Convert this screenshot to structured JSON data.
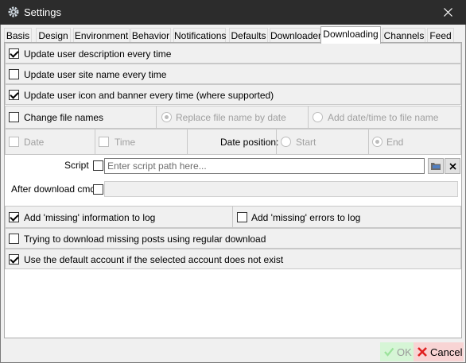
{
  "window": {
    "title": "Settings"
  },
  "tabs": [
    "Basis",
    "Design",
    "Environment",
    "Behavior",
    "Notifications",
    "Defaults",
    "Downloader",
    "Downloading",
    "Channels",
    "Feed"
  ],
  "options": {
    "update_description": {
      "label": "Update user description every time",
      "checked": true
    },
    "update_site_name": {
      "label": "Update user site name every time",
      "checked": false
    },
    "update_icon_banner": {
      "label": "Update user icon and banner every time (where supported)",
      "checked": true
    },
    "change_file_names": {
      "label": "Change file names",
      "checked": false
    },
    "replace_by_date": {
      "label": "Replace file name by date",
      "selected": true
    },
    "add_date_time": {
      "label": "Add date/time to file name",
      "selected": false
    },
    "date": {
      "label": "Date",
      "checked": false
    },
    "time": {
      "label": "Time",
      "checked": false
    },
    "date_position": {
      "label": "Date position:",
      "start": "Start",
      "end": "End",
      "selected": "End"
    },
    "script": {
      "label": "Script",
      "checked": false,
      "placeholder": "Enter script path here...",
      "value": ""
    },
    "after_download_cmd": {
      "label": "After download cmd",
      "checked": false,
      "value": ""
    },
    "add_missing_info": {
      "label": "Add 'missing' information to log",
      "checked": true
    },
    "add_missing_errors": {
      "label": "Add 'missing' errors to log",
      "checked": false
    },
    "try_download_missing": {
      "label": "Trying to download missing posts using regular download",
      "checked": false
    },
    "use_default_account": {
      "label": "Use the default account if the selected account does not exist",
      "checked": true
    }
  },
  "buttons": {
    "ok": "OK",
    "cancel": "Cancel"
  },
  "colors": {
    "titlebar": "#2c2c2c",
    "ok_bg": "#d6f5d6",
    "cancel_bg": "#f8d4d4",
    "check_green": "#4caf50",
    "cancel_red": "#e02020"
  }
}
